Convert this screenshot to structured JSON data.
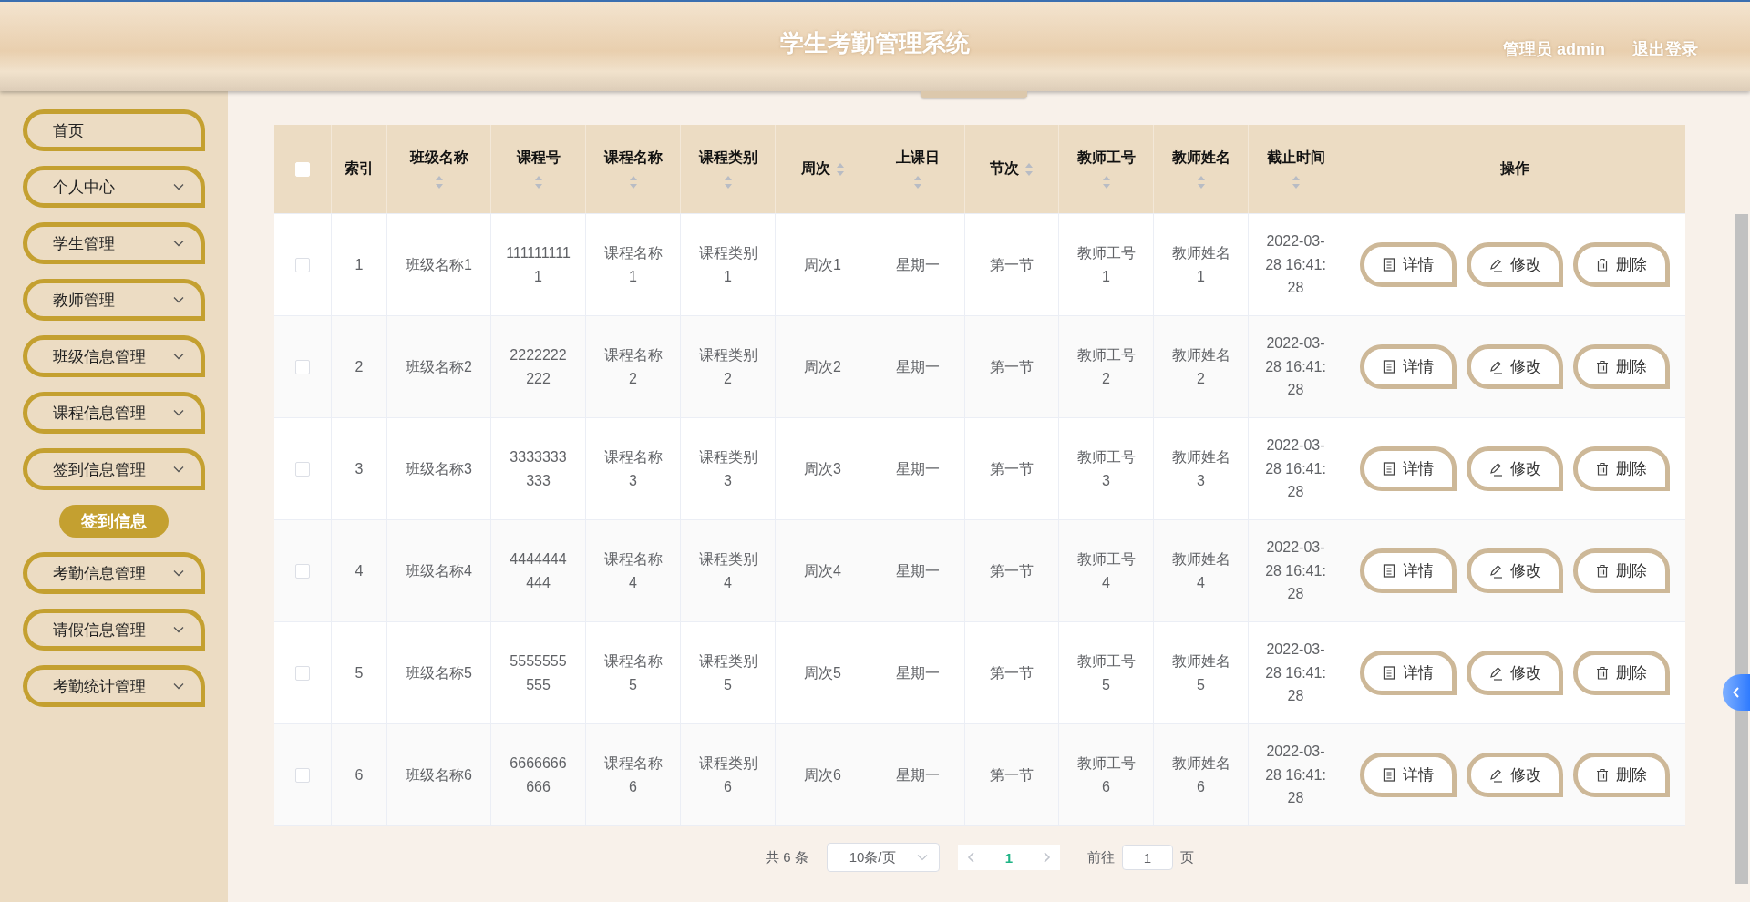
{
  "header": {
    "title": "学生考勤管理系统",
    "user": "管理员 admin",
    "logout": "退出登录"
  },
  "sidebar": {
    "items": [
      {
        "label": "首页",
        "expandable": false
      },
      {
        "label": "个人中心",
        "expandable": true
      },
      {
        "label": "学生管理",
        "expandable": true
      },
      {
        "label": "教师管理",
        "expandable": true
      },
      {
        "label": "班级信息管理",
        "expandable": true
      },
      {
        "label": "课程信息管理",
        "expandable": true
      },
      {
        "label": "签到信息管理",
        "expandable": true,
        "children": [
          {
            "label": "签到信息",
            "selected": true
          }
        ]
      },
      {
        "label": "考勤信息管理",
        "expandable": true
      },
      {
        "label": "请假信息管理",
        "expandable": true
      },
      {
        "label": "考勤统计管理",
        "expandable": true
      }
    ]
  },
  "table": {
    "select_all_checked": false,
    "columns": [
      {
        "label": "索引",
        "sortable": false
      },
      {
        "label": "班级名称",
        "sortable": true
      },
      {
        "label": "课程号",
        "sortable": true
      },
      {
        "label": "课程名称",
        "sortable": true
      },
      {
        "label": "课程类别",
        "sortable": true
      },
      {
        "label": "周次",
        "sortable": true
      },
      {
        "label": "上课日",
        "sortable": true
      },
      {
        "label": "节次",
        "sortable": true
      },
      {
        "label": "教师工号",
        "sortable": true
      },
      {
        "label": "教师姓名",
        "sortable": true
      },
      {
        "label": "截止时间",
        "sortable": true
      },
      {
        "label": "操作",
        "sortable": false
      }
    ],
    "rows": [
      {
        "checked": false,
        "cells": [
          "1",
          "班级名称1",
          "1111111111",
          "课程名称1",
          "课程类别1",
          "周次1",
          "星期一",
          "第一节",
          "教师工号1",
          "教师姓名1",
          "2022-03-28 16:41:28"
        ],
        "actions": [
          {
            "kind": "detail",
            "label": "详情"
          },
          {
            "kind": "edit",
            "label": "修改"
          },
          {
            "kind": "delete",
            "label": "删除"
          }
        ]
      },
      {
        "checked": false,
        "cells": [
          "2",
          "班级名称2",
          "2222222222",
          "课程名称2",
          "课程类别2",
          "周次2",
          "星期一",
          "第一节",
          "教师工号2",
          "教师姓名2",
          "2022-03-28 16:41:28"
        ],
        "actions": [
          {
            "kind": "detail",
            "label": "详情"
          },
          {
            "kind": "edit",
            "label": "修改"
          },
          {
            "kind": "delete",
            "label": "删除"
          }
        ]
      },
      {
        "checked": false,
        "cells": [
          "3",
          "班级名称3",
          "3333333333",
          "课程名称3",
          "课程类别3",
          "周次3",
          "星期一",
          "第一节",
          "教师工号3",
          "教师姓名3",
          "2022-03-28 16:41:28"
        ],
        "actions": [
          {
            "kind": "detail",
            "label": "详情"
          },
          {
            "kind": "edit",
            "label": "修改"
          },
          {
            "kind": "delete",
            "label": "删除"
          }
        ]
      },
      {
        "checked": false,
        "cells": [
          "4",
          "班级名称4",
          "4444444444",
          "课程名称4",
          "课程类别4",
          "周次4",
          "星期一",
          "第一节",
          "教师工号4",
          "教师姓名4",
          "2022-03-28 16:41:28"
        ],
        "actions": [
          {
            "kind": "detail",
            "label": "详情"
          },
          {
            "kind": "edit",
            "label": "修改"
          },
          {
            "kind": "delete",
            "label": "删除"
          }
        ]
      },
      {
        "checked": false,
        "cells": [
          "5",
          "班级名称5",
          "5555555555",
          "课程名称5",
          "课程类别5",
          "周次5",
          "星期一",
          "第一节",
          "教师工号5",
          "教师姓名5",
          "2022-03-28 16:41:28"
        ],
        "actions": [
          {
            "kind": "detail",
            "label": "详情"
          },
          {
            "kind": "edit",
            "label": "修改"
          },
          {
            "kind": "delete",
            "label": "删除"
          }
        ]
      },
      {
        "checked": false,
        "cells": [
          "6",
          "班级名称6",
          "6666666666",
          "课程名称6",
          "课程类别6",
          "周次6",
          "星期一",
          "第一节",
          "教师工号6",
          "教师姓名6",
          "2022-03-28 16:41:28"
        ],
        "actions": [
          {
            "kind": "detail",
            "label": "详情"
          },
          {
            "kind": "edit",
            "label": "修改"
          },
          {
            "kind": "delete",
            "label": "删除"
          }
        ]
      }
    ]
  },
  "pagination": {
    "total": "共 6 条",
    "page_size": "10条/页",
    "pages": [
      {
        "label": "1",
        "selected": true
      }
    ],
    "goto_label": "前往",
    "goto_value": "1",
    "goto_suffix": "页"
  }
}
